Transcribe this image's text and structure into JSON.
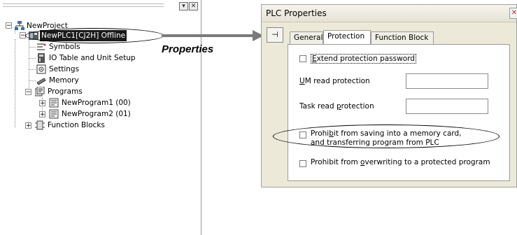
{
  "tree_pane": {
    "titlebar_buttons": [
      "▾",
      "✕"
    ],
    "items": [
      {
        "label": "NewProject",
        "icon": "project-icon"
      },
      {
        "label": "NewPLC1[CJ2H] Offline",
        "icon": "plc-icon",
        "selected": true
      },
      {
        "label": "Symbols",
        "icon": "symbols-icon"
      },
      {
        "label": "IO Table and Unit Setup",
        "icon": "io-table-icon"
      },
      {
        "label": "Settings",
        "icon": "settings-icon"
      },
      {
        "label": "Memory",
        "icon": "memory-icon"
      },
      {
        "label": "Programs",
        "icon": "programs-icon"
      },
      {
        "label": "NewProgram1 (00)",
        "icon": "program-icon"
      },
      {
        "label": "NewProgram2 (01)",
        "icon": "program-icon"
      },
      {
        "label": "Function Blocks",
        "icon": "function-blocks-icon"
      }
    ]
  },
  "annotation": {
    "label": "Properties"
  },
  "dialog": {
    "title": "PLC Properties",
    "tabs": [
      "General",
      "Protection",
      "Function Block"
    ],
    "active_tab": "Protection",
    "extend_password": {
      "prefix": "",
      "underline": "E",
      "rest": "xtend protection password"
    },
    "um_read": {
      "underline": "U",
      "rest": "M read protection"
    },
    "task_read": {
      "prefix": "Task read ",
      "underline": "p",
      "rest": "rotection"
    },
    "prohibit_save_line1": {
      "prefix": "Prohi",
      "underline": "b",
      "rest": "it from saving into a memory card,"
    },
    "prohibit_save_line2": "and transferring program from PLC",
    "prohibit_overwrite": {
      "prefix": "Prohibit from ",
      "underline": "o",
      "rest": "verwriting to a protected program"
    }
  }
}
